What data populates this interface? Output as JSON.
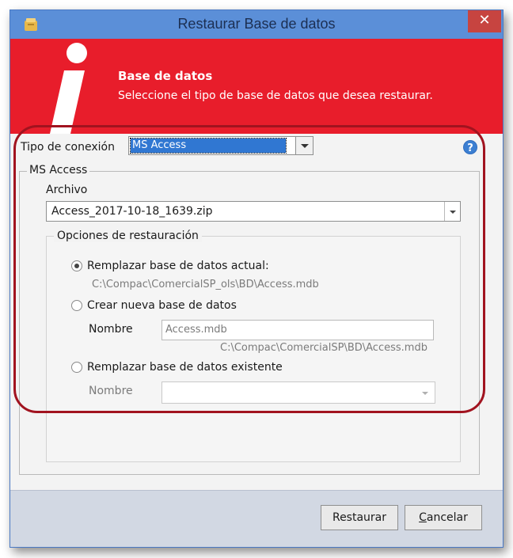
{
  "window": {
    "title": "Restaurar Base de datos",
    "close_glyph": "✕"
  },
  "banner": {
    "title": "Base de datos",
    "subtitle": "Seleccione el tipo de base de datos que desea restaurar.",
    "logo_icon": "info-i-logo"
  },
  "connection": {
    "label": "Tipo de conexión",
    "selected": "MS Access"
  },
  "ms_access": {
    "group_label": "MS Access",
    "file_label": "Archivo",
    "file_value": "Access_2017-10-18_1639.zip"
  },
  "options": {
    "group_label": "Opciones de restauración",
    "replace_current_label": "Remplazar base de datos actual:",
    "replace_current_path": "C:\\Compac\\ComercialSP_ols\\BD\\Access.mdb",
    "create_new_label": "Crear nueva base de datos",
    "create_new_name_label": "Nombre",
    "create_new_name_value": "Access.mdb",
    "create_new_path": "C:\\Compac\\ComercialSP\\BD\\Access.mdb",
    "replace_existing_label": "Remplazar base de datos existente",
    "replace_existing_name_label": "Nombre",
    "selected_option": "replace_current"
  },
  "buttons": {
    "restore": "Restaurar",
    "cancel_prefix": "C",
    "cancel_rest": "ancelar"
  },
  "colors": {
    "titlebar": "#5b8fd8",
    "banner": "#e81d2b",
    "highlight": "#a1131f",
    "footer": "#d2d8e3"
  }
}
